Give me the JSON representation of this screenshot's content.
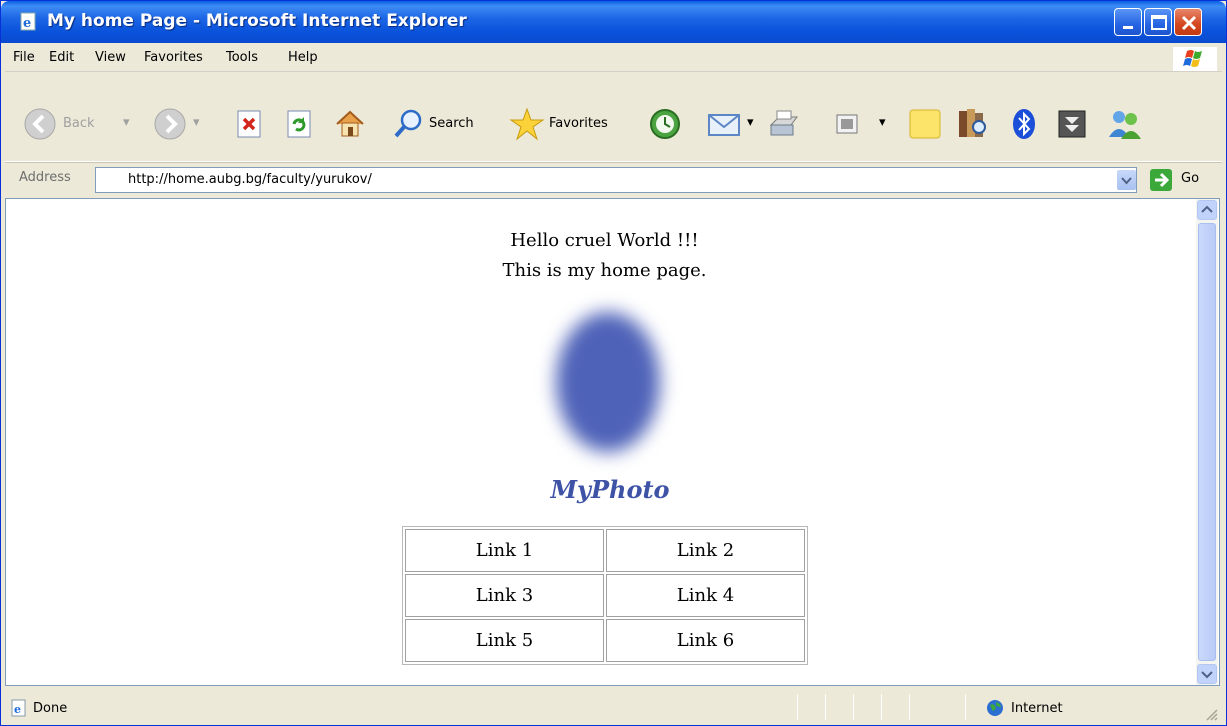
{
  "window": {
    "title": "My home Page - Microsoft Internet Explorer"
  },
  "menu": {
    "items": [
      "File",
      "Edit",
      "View",
      "Favorites",
      "Tools",
      "Help"
    ]
  },
  "toolbar": {
    "back_label": "Back",
    "search_label": "Search",
    "favorites_label": "Favorites"
  },
  "address": {
    "label": "Address",
    "url": "http://home.aubg.bg/faculty/yurukov/",
    "go_label": "Go"
  },
  "page": {
    "greeting": "Hello cruel World !!!",
    "subtitle": "This is my home page.",
    "photo_caption": "MyPhoto",
    "links": [
      "Link 1",
      "Link 2",
      "Link 3",
      "Link 4",
      "Link 5",
      "Link 6"
    ]
  },
  "status": {
    "text": "Done",
    "zone": "Internet"
  },
  "colors": {
    "titlebar": "#0A54DC",
    "photo": "#4E62B8",
    "caption": "#3E52A6"
  }
}
